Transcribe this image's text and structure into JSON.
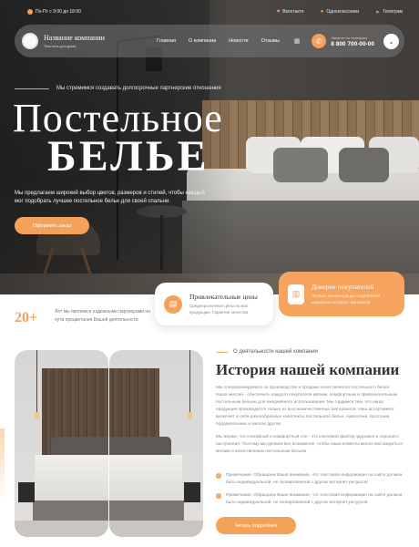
{
  "topbar": {
    "hours": "Пн-Пт с 9:00 до 18:00",
    "socials": [
      {
        "label": "Вконтакте",
        "icon": "vk-icon"
      },
      {
        "label": "Одноклассники",
        "icon": "ok-icon"
      },
      {
        "label": "Телеграм",
        "icon": "telegram-icon"
      }
    ]
  },
  "header": {
    "company_name": "Название компании",
    "company_tag": "Текстиль для дома",
    "menu": [
      "Главная",
      "О компании",
      "Новости",
      "Отзывы"
    ],
    "phone_label": "Звоните по телефону",
    "phone": "8 800 700-00-00"
  },
  "hero": {
    "tagline": "Мы стремимся создавать долгосрочные партнерские отношения",
    "title_line1": "Постельное",
    "title_line2": "БЕЛЬЕ",
    "description": "Мы предлагаем широкий выбор цветов, размеров и стилей, чтобы каждый мог подобрать лучшее постельное белье для своей спальни.",
    "cta": "Оформить заказ"
  },
  "features": {
    "stat_number": "20+",
    "stat_text": "Лет мы являемся надежными партнерами на пути процветания Вашей деятельности",
    "card1": {
      "title": "Привлекательные цены",
      "text": "Среднерыночные цены на всю продукцию. Гарантия качества"
    },
    "card2": {
      "title": "Доверие покупателей",
      "text": "Лучшие рекомендации покупателей надежных интернет-магазинов"
    }
  },
  "about": {
    "label": "О деятельности нашей компании",
    "title": "История нашей компании",
    "paragraph1": "Мы специализируемся на производстве и продаже качественного постельного белья. Наша миссия - обеспечить каждого покупателя мягким, комфортным и привлекательным постельным бельем для ежедневного использования. Мы гордимся тем, что наша продукция производится только из высококачественных материалов. Наш ассортимент включает в себя разнообразные комплекты постельного белья, наволочки, простыни, пододеяльники и многое другое.",
    "paragraph2": "Мы верим, что спокойный и комфортный сон - это ключевой фактор здоровья и хорошего настроения. Поэтому мы делаем все возможное, чтобы наши клиенты могли наслаждаться мягким и качественным постельным бельем.",
    "bullets": [
      "Примечание. Обращаем Ваше внимание, что текстовая информация на сайте должна быть индивидуальной, не скопированной с других интернет-ресурсов",
      "Примечание. Обращаем Ваше внимание, что текстовая информация на сайте должна быть индивидуальной, не скопированной с других интернет-ресурсов"
    ],
    "more_button": "Читать подробнее"
  },
  "colors": {
    "accent": "#f4a259",
    "dark": "#333333"
  }
}
